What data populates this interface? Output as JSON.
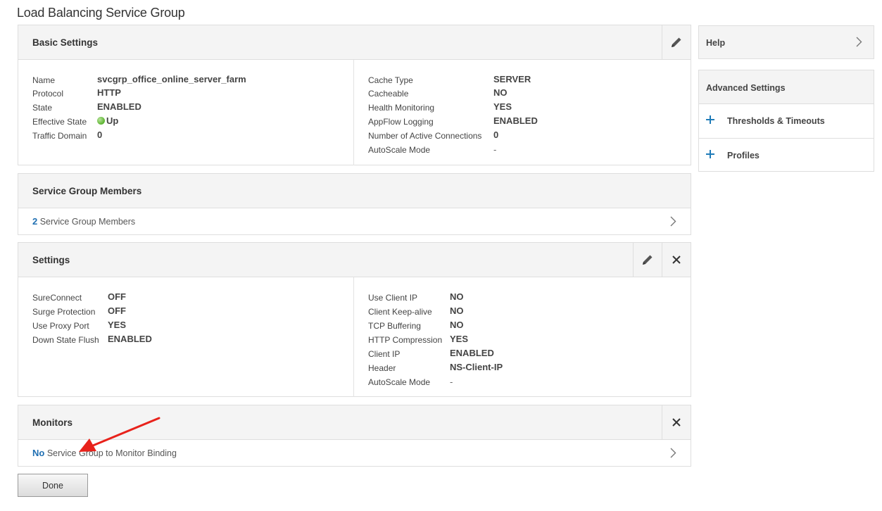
{
  "page": {
    "title": "Load Balancing Service Group"
  },
  "basic_settings": {
    "title": "Basic Settings",
    "left": [
      {
        "label": "Name",
        "value": "svcgrp_office_online_server_farm"
      },
      {
        "label": "Protocol",
        "value": "HTTP"
      },
      {
        "label": "State",
        "value": "ENABLED"
      },
      {
        "label": "Effective State",
        "value": "Up"
      },
      {
        "label": "Traffic Domain",
        "value": "0"
      }
    ],
    "right": [
      {
        "label": "Cache Type",
        "value": "SERVER"
      },
      {
        "label": "Cacheable",
        "value": "NO"
      },
      {
        "label": "Health Monitoring",
        "value": "YES"
      },
      {
        "label": "AppFlow Logging",
        "value": "ENABLED"
      },
      {
        "label": "Number of Active Connections",
        "value": "0"
      },
      {
        "label": "AutoScale Mode",
        "value": "-"
      }
    ]
  },
  "members": {
    "title": "Service Group Members",
    "count": "2",
    "link_text": " Service Group Members"
  },
  "settings": {
    "title": "Settings",
    "left": [
      {
        "label": "SureConnect",
        "value": "OFF"
      },
      {
        "label": "Surge Protection",
        "value": "OFF"
      },
      {
        "label": "Use Proxy Port",
        "value": "YES"
      },
      {
        "label": "Down State Flush",
        "value": "ENABLED"
      }
    ],
    "right": [
      {
        "label": "Use Client IP",
        "value": "NO"
      },
      {
        "label": "Client Keep-alive",
        "value": "NO"
      },
      {
        "label": "TCP Buffering",
        "value": "NO"
      },
      {
        "label": "HTTP Compression",
        "value": "YES"
      },
      {
        "label": "Client IP",
        "value": "ENABLED"
      },
      {
        "label": "Header",
        "value": "NS-Client-IP"
      },
      {
        "label": "AutoScale Mode",
        "value": "-"
      }
    ]
  },
  "monitors": {
    "title": "Monitors",
    "count": "No",
    "link_text": " Service Group to Monitor Binding"
  },
  "sidebar": {
    "help": "Help",
    "advanced_title": "Advanced Settings",
    "items": [
      {
        "label": "Thresholds & Timeouts"
      },
      {
        "label": "Profiles"
      }
    ]
  },
  "footer": {
    "done_label": "Done"
  },
  "colors": {
    "accent": "#1f6fb2",
    "plus": "#1f7bb8",
    "annotation": "#e8221b",
    "state_up": "#5cb431"
  },
  "icons": {
    "edit": "pencil-icon",
    "close": "close-icon",
    "chevron": "chevron-right-icon",
    "add": "plus-icon",
    "status": "green-dot-icon"
  }
}
